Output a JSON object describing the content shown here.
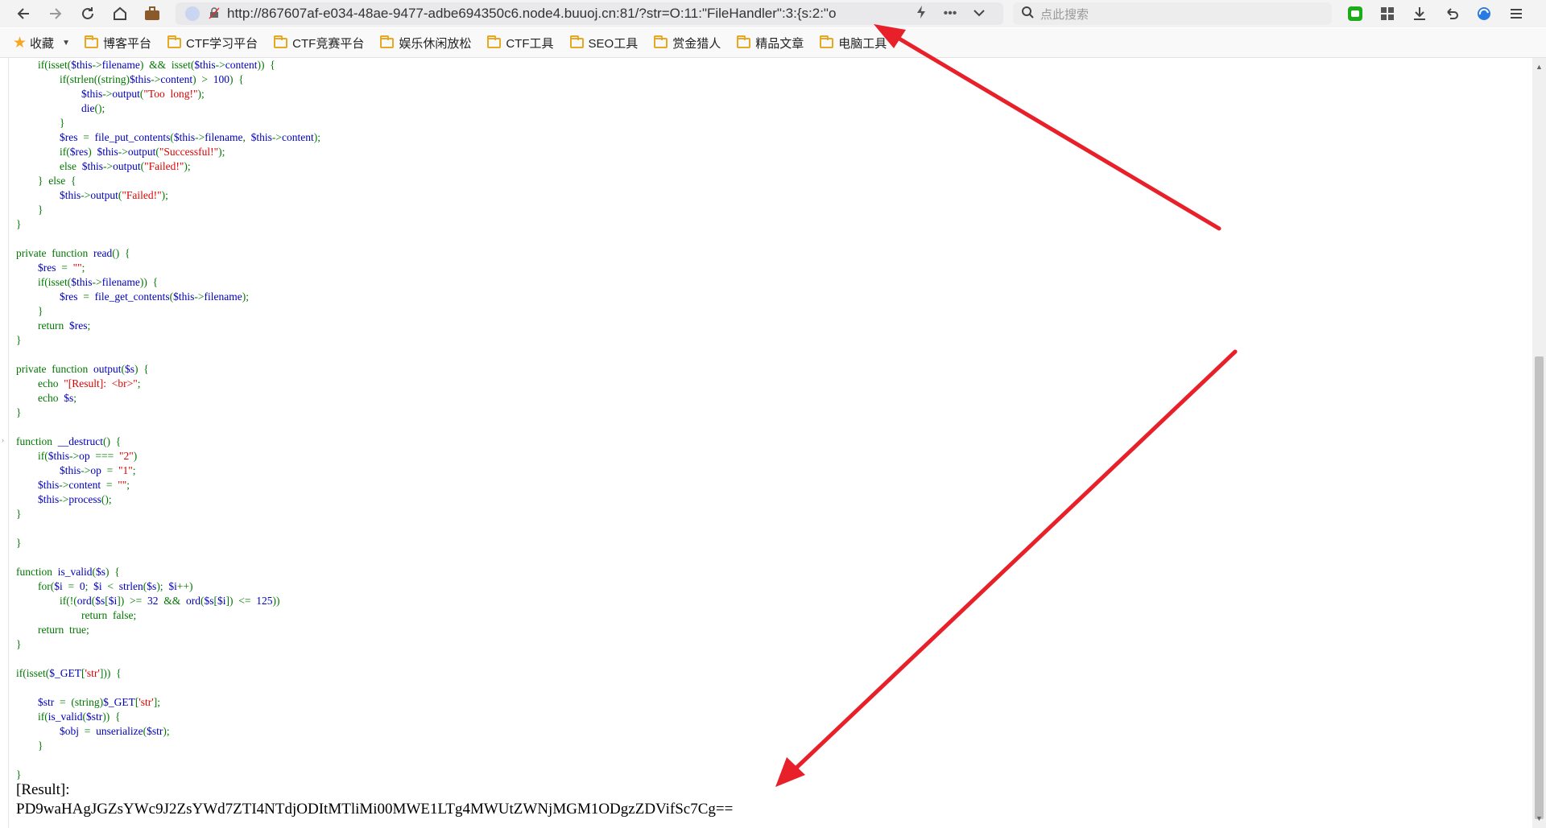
{
  "browser": {
    "url": "http://867607af-e034-48ae-9477-adbe694350c6.node4.buuoj.cn:81/?str=O:11:\"FileHandler\":3:{s:2:\"o",
    "search_placeholder": "点此搜索"
  },
  "bookmarks": {
    "favorites_label": "收藏",
    "items": [
      "博客平台",
      "CTF学习平台",
      "CTF竞赛平台",
      "娱乐休闲放松",
      "CTF工具",
      "SEO工具",
      "赏金猎人",
      "精品文章",
      "电脑工具"
    ]
  },
  "page": {
    "result_label": "[Result]:",
    "result_value": "PD9waHAgJGZsYWc9J2ZsYWd7ZTI4NTdjODItMTliMi00MWE1LTg4MWUtZWNjMGM1ODgzZDVifSc7Cg=="
  },
  "colors": {
    "arrow": "#e8202a",
    "keyword": "#007700",
    "variable": "#0000bb",
    "string": "#dd0000"
  },
  "icons": [
    "back-icon",
    "forward-icon",
    "reload-icon",
    "home-icon",
    "briefcase-icon",
    "lock-slash-icon",
    "lightning-icon",
    "more-icon",
    "chevron-down-icon",
    "search-icon",
    "wechat-icon",
    "apps-icon",
    "download-icon",
    "undo-icon",
    "browser-logo-icon",
    "menu-icon",
    "star-icon",
    "folder-icon"
  ]
}
